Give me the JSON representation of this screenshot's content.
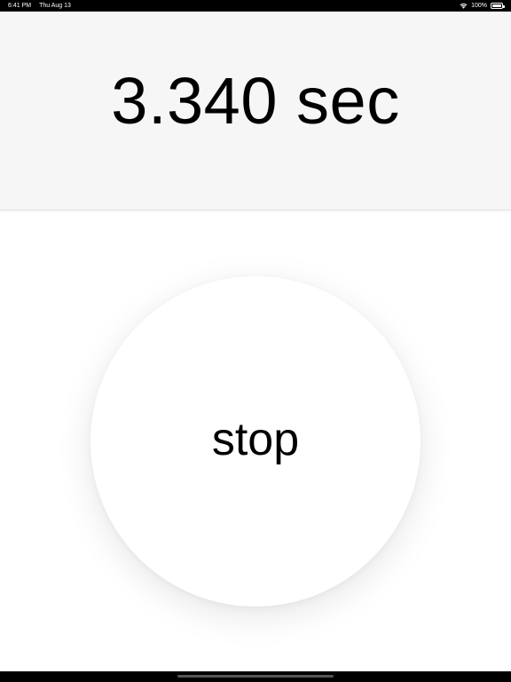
{
  "status_bar": {
    "time": "6:41 PM",
    "date": "Thu Aug 13",
    "battery_text": "100%",
    "wifi_icon": "wifi-icon",
    "battery_icon": "battery-icon",
    "battery_level": 1.0
  },
  "timer": {
    "readout": "3.340 sec"
  },
  "controls": {
    "stop_label": "stop"
  },
  "colors": {
    "panel_background": "#f6f6f6",
    "page_background": "#ffffff",
    "text": "#000000"
  }
}
